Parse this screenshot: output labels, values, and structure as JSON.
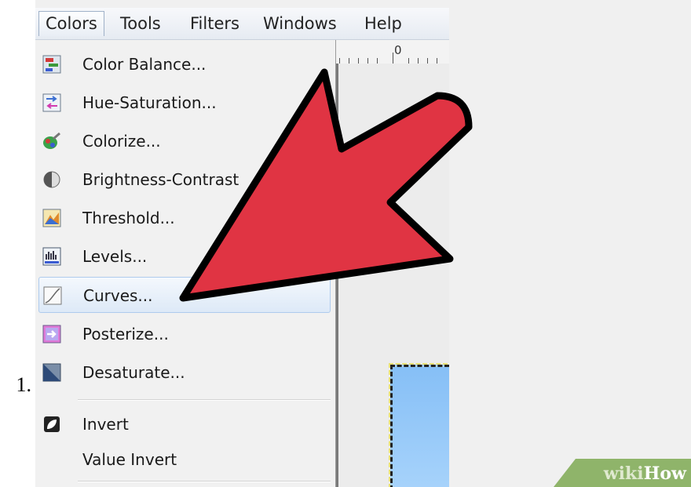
{
  "step_number": "1.",
  "menubar": {
    "items": [
      {
        "label": "Colors",
        "active": true
      },
      {
        "label": "Tools"
      },
      {
        "label": "Filters"
      },
      {
        "label": "Windows"
      },
      {
        "label": "Help"
      }
    ]
  },
  "ruler": {
    "label": "0"
  },
  "menu": {
    "items": [
      {
        "label": "Color Balance...",
        "icon": "color-balance-icon"
      },
      {
        "label": "Hue-Saturation...",
        "icon": "hue-saturation-icon"
      },
      {
        "label": "Colorize...",
        "icon": "colorize-icon"
      },
      {
        "label": "Brightness-Contrast",
        "icon": "brightness-contrast-icon"
      },
      {
        "label": "Threshold...",
        "icon": "threshold-icon"
      },
      {
        "label": "Levels...",
        "icon": "levels-icon"
      },
      {
        "label": "Curves...",
        "icon": "curves-icon",
        "highlighted": true
      },
      {
        "label": "Posterize...",
        "icon": "posterize-icon"
      },
      {
        "label": "Desaturate...",
        "icon": "desaturate-icon"
      },
      {
        "label": "Invert",
        "icon": "invert-icon"
      },
      {
        "label": "Value Invert"
      }
    ]
  },
  "watermark": {
    "wiki": "wiki",
    "how": "How"
  },
  "colors": {
    "arrow": "#e03443",
    "watermark_green": "#8fb46a",
    "highlight_border": "#aecbed"
  }
}
